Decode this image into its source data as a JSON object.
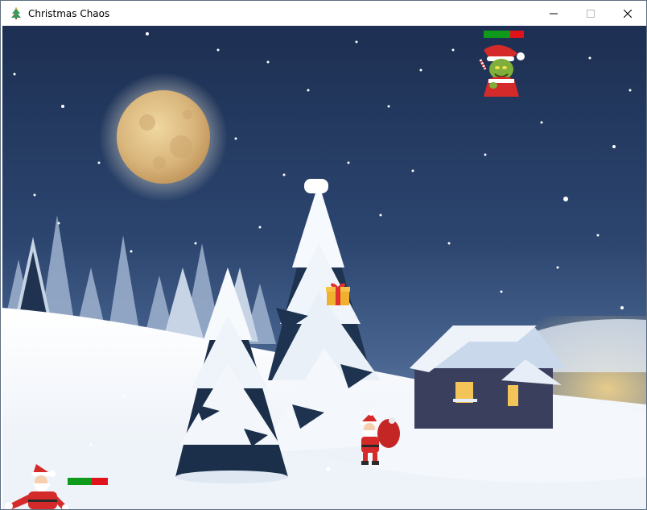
{
  "window": {
    "title": "Christmas Chaos",
    "icon": "christmas-tree-icon",
    "controls": [
      "minimize-icon",
      "maximize-icon",
      "close-icon"
    ]
  },
  "game": {
    "scene": "snowy-night-village",
    "elements": [
      "moon",
      "snowy-pine-trees",
      "cabin",
      "gift-in-tree"
    ],
    "enemy": {
      "name": "grinch",
      "health": 0.65,
      "health_colors": {
        "fill": "#0e9a1a",
        "empty": "#e0121b"
      }
    },
    "player": {
      "name": "santa",
      "health": 0.6,
      "health_colors": {
        "fill": "#0e9a1a",
        "empty": "#e0121b"
      }
    },
    "npc": {
      "name": "santa-with-sack"
    },
    "pickup": {
      "name": "gift-box"
    }
  }
}
